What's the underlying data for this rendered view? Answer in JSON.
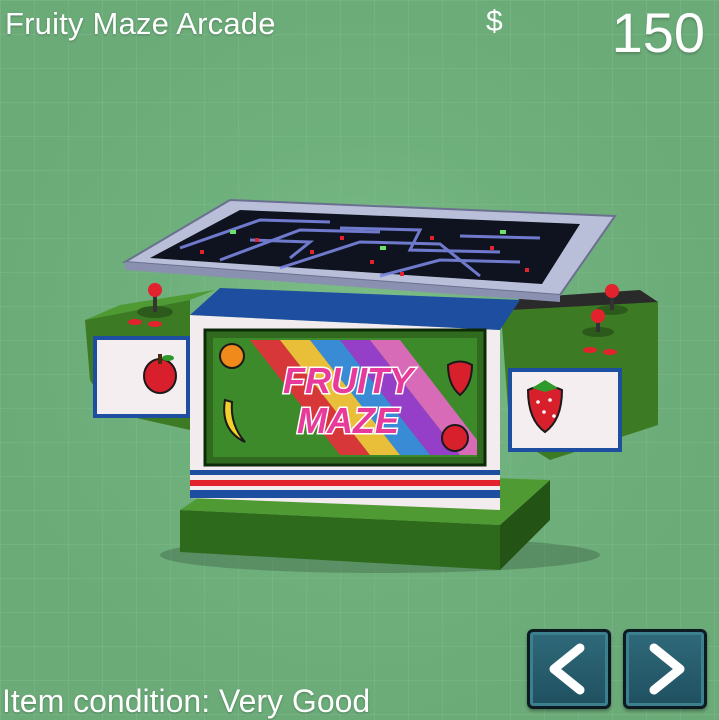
{
  "item": {
    "name": "Fruity Maze Arcade",
    "condition_label": "Item condition: Very Good"
  },
  "wallet": {
    "currency_symbol": "$",
    "amount": "150"
  },
  "marquee": {
    "line1": "FRUITY",
    "line2": "MAZE"
  },
  "navigation": {
    "prev_icon": "chevron-left-icon",
    "next_icon": "chevron-right-icon"
  },
  "colors": {
    "background": "#6bab78",
    "button": "#2a6474",
    "cabinet_green": "#5a9a3a",
    "accent_red": "#e0333a"
  }
}
